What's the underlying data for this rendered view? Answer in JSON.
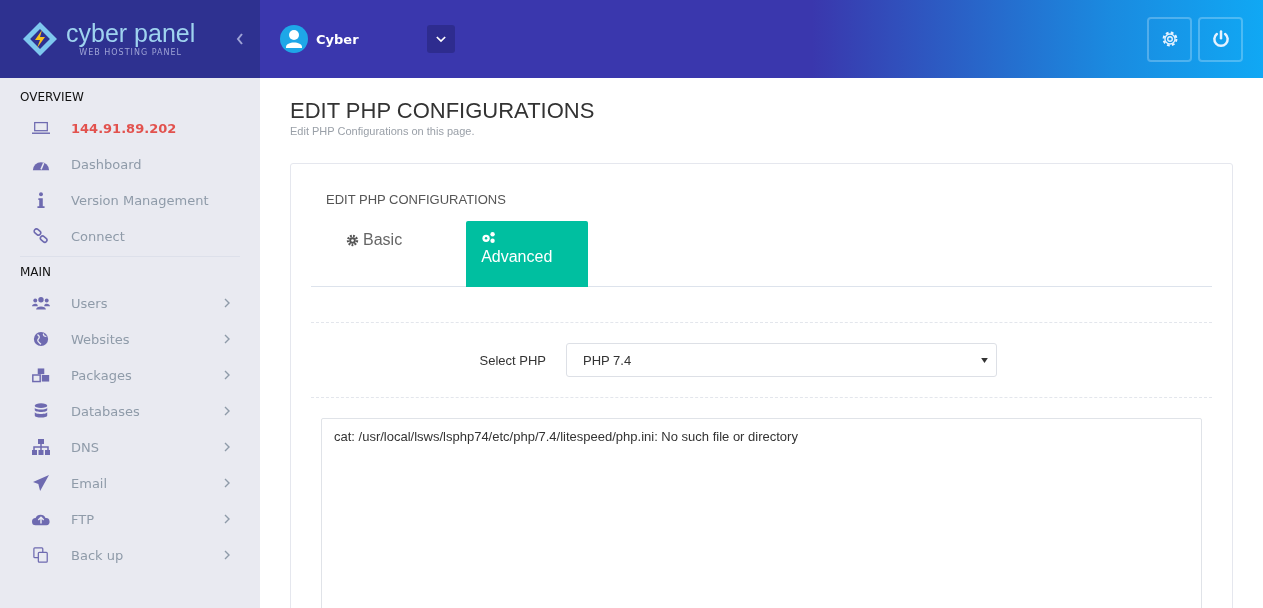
{
  "brand": {
    "name": "cyber panel",
    "tagline": "WEB HOSTING PANEL"
  },
  "header": {
    "user": "Cyber"
  },
  "sidebar": {
    "sections": [
      {
        "title": "OVERVIEW",
        "items": [
          {
            "label": "144.91.89.202",
            "selected": true,
            "expandable": false
          },
          {
            "label": "Dashboard",
            "selected": false,
            "expandable": false
          },
          {
            "label": "Version Management",
            "selected": false,
            "expandable": false
          },
          {
            "label": "Connect",
            "selected": false,
            "expandable": false
          }
        ]
      },
      {
        "title": "MAIN",
        "items": [
          {
            "label": "Users",
            "selected": false,
            "expandable": true
          },
          {
            "label": "Websites",
            "selected": false,
            "expandable": true
          },
          {
            "label": "Packages",
            "selected": false,
            "expandable": true
          },
          {
            "label": "Databases",
            "selected": false,
            "expandable": true
          },
          {
            "label": "DNS",
            "selected": false,
            "expandable": true
          },
          {
            "label": "Email",
            "selected": false,
            "expandable": true
          },
          {
            "label": "FTP",
            "selected": false,
            "expandable": true
          },
          {
            "label": "Back up",
            "selected": false,
            "expandable": true
          }
        ]
      }
    ]
  },
  "page": {
    "title": "EDIT PHP CONFIGURATIONS",
    "subtitle": "Edit PHP Configurations on this page."
  },
  "card": {
    "title": "EDIT PHP CONFIGURATIONS",
    "tabs": [
      {
        "label": "Basic",
        "selected": false
      },
      {
        "label": "Advanced",
        "selected": true
      }
    ],
    "select": {
      "label": "Select PHP",
      "value": "PHP 7.4"
    },
    "editor": {
      "value": "cat: /usr/local/lsws/lsphp74/etc/php/7.4/litespeed/php.ini: No such file or directory"
    }
  }
}
